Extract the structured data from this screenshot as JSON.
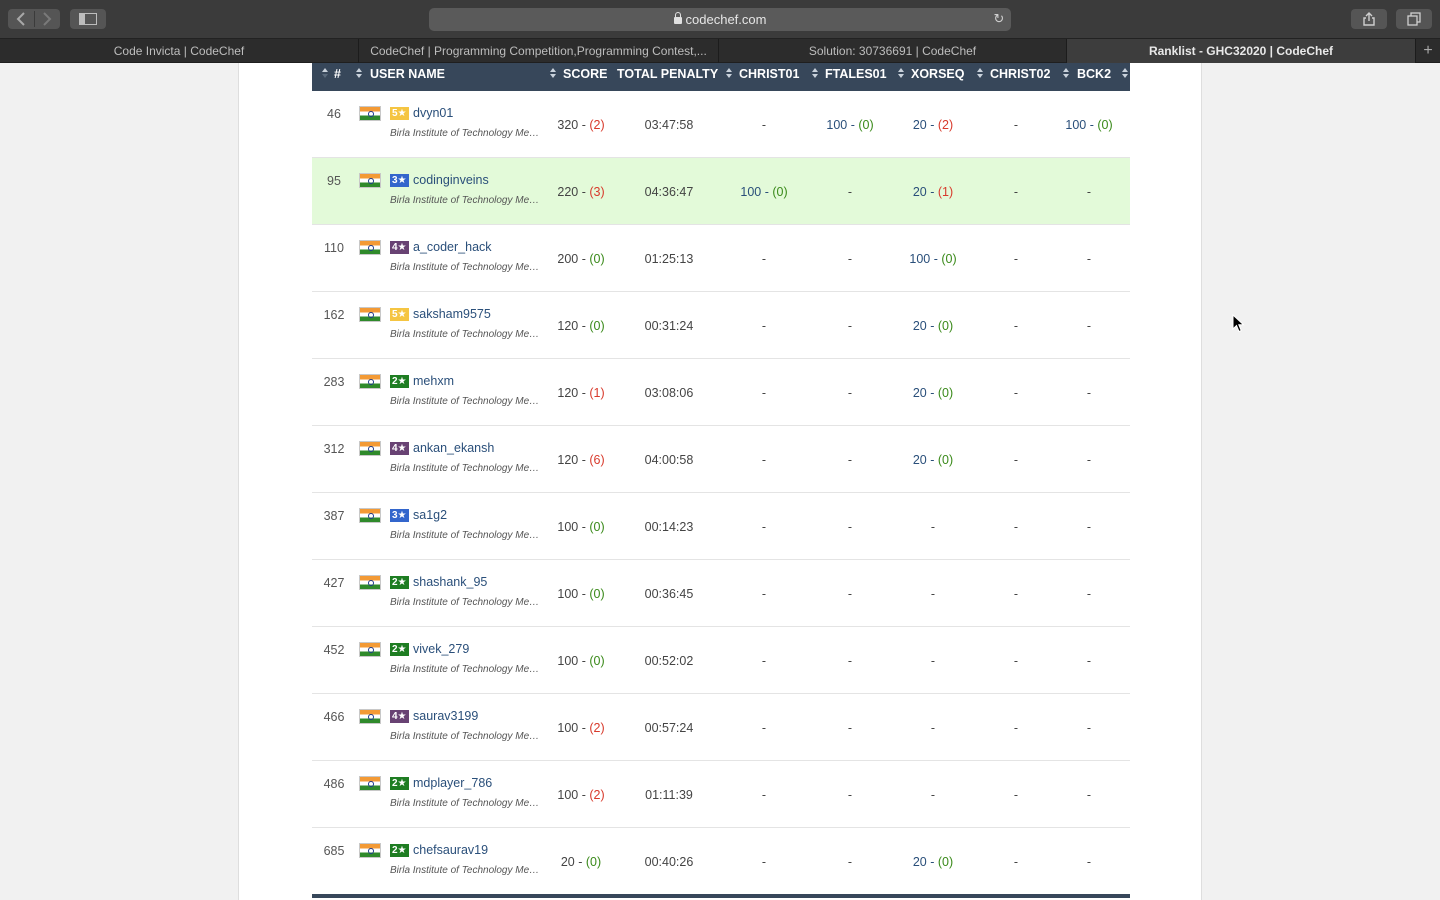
{
  "browser": {
    "url": "codechef.com",
    "tabs": [
      {
        "label": "Code Invicta | CodeChef"
      },
      {
        "label": "CodeChef | Programming Competition,Programming Contest,..."
      },
      {
        "label": "Solution: 30736691 | CodeChef"
      },
      {
        "label": "Ranklist - GHC32020 | CodeChef"
      }
    ]
  },
  "table": {
    "headers": {
      "rank": "#",
      "username": "USER NAME",
      "score": "SCORE",
      "penalty": "TOTAL PENALTY",
      "p1": "CHRIST01",
      "p2": "FTALES01",
      "p3": "XORSEQ",
      "p4": "CHRIST02",
      "p5": "BCK2"
    },
    "rows": [
      {
        "rank": "46",
        "stars": "5★",
        "user": "dvyn01",
        "inst": "Birla Institute of Technology Mesra",
        "score": "320",
        "score_pen": "(2)",
        "time": "03:47:58",
        "p1": "-",
        "p2": "100",
        "p2p": "(0)",
        "p3": "20",
        "p3p": "(2)",
        "p4": "-",
        "p5": "100",
        "p5p": "(0)"
      },
      {
        "rank": "95",
        "stars": "3★",
        "user": "codinginveins",
        "inst": "Birla Institute of Technology Mesra",
        "score": "220",
        "score_pen": "(3)",
        "time": "04:36:47",
        "p1": "100",
        "p1p": "(0)",
        "p2": "-",
        "p3": "20",
        "p3p": "(1)",
        "p4": "-",
        "p5": "-"
      },
      {
        "rank": "110",
        "stars": "4★",
        "user": "a_coder_hack",
        "inst": "Birla Institute of Technology Mesra",
        "score": "200",
        "score_pen": "(0)",
        "time": "01:25:13",
        "p1": "-",
        "p2": "-",
        "p3": "100",
        "p3p": "(0)",
        "p4": "-",
        "p5": "-"
      },
      {
        "rank": "162",
        "stars": "5★",
        "user": "saksham9575",
        "inst": "Birla Institute of Technology Mesra",
        "score": "120",
        "score_pen": "(0)",
        "time": "00:31:24",
        "p1": "-",
        "p2": "-",
        "p3": "20",
        "p3p": "(0)",
        "p4": "-",
        "p5": "-"
      },
      {
        "rank": "283",
        "stars": "2★",
        "user": "mehxm",
        "inst": "Birla Institute of Technology Mesra",
        "score": "120",
        "score_pen": "(1)",
        "time": "03:08:06",
        "p1": "-",
        "p2": "-",
        "p3": "20",
        "p3p": "(0)",
        "p4": "-",
        "p5": "-"
      },
      {
        "rank": "312",
        "stars": "4★",
        "user": "ankan_ekansh",
        "inst": "Birla Institute of Technology Mesra",
        "score": "120",
        "score_pen": "(6)",
        "time": "04:00:58",
        "p1": "-",
        "p2": "-",
        "p3": "20",
        "p3p": "(0)",
        "p4": "-",
        "p5": "-"
      },
      {
        "rank": "387",
        "stars": "3★",
        "user": "sa1g2",
        "inst": "Birla Institute of Technology Mesra",
        "score": "100",
        "score_pen": "(0)",
        "time": "00:14:23",
        "p1": "-",
        "p2": "-",
        "p3": "-",
        "p4": "-",
        "p5": "-"
      },
      {
        "rank": "427",
        "stars": "2★",
        "user": "shashank_95",
        "inst": "Birla Institute of Technology Mesra",
        "score": "100",
        "score_pen": "(0)",
        "time": "00:36:45",
        "p1": "-",
        "p2": "-",
        "p3": "-",
        "p4": "-",
        "p5": "-"
      },
      {
        "rank": "452",
        "stars": "2★",
        "user": "vivek_279",
        "inst": "Birla Institute of Technology Mesra",
        "score": "100",
        "score_pen": "(0)",
        "time": "00:52:02",
        "p1": "-",
        "p2": "-",
        "p3": "-",
        "p4": "-",
        "p5": "-"
      },
      {
        "rank": "466",
        "stars": "4★",
        "user": "saurav3199",
        "inst": "Birla Institute of Technology Mesra",
        "score": "100",
        "score_pen": "(2)",
        "time": "00:57:24",
        "p1": "-",
        "p2": "-",
        "p3": "-",
        "p4": "-",
        "p5": "-"
      },
      {
        "rank": "486",
        "stars": "2★",
        "user": "mdplayer_786",
        "inst": "Birla Institute of Technology Mesra",
        "score": "100",
        "score_pen": "(2)",
        "time": "01:11:39",
        "p1": "-",
        "p2": "-",
        "p3": "-",
        "p4": "-",
        "p5": "-"
      },
      {
        "rank": "685",
        "stars": "2★",
        "user": "chefsaurav19",
        "inst": "Birla Institute of Technology Mesra",
        "score": "20",
        "score_pen": "(0)",
        "time": "00:40:26",
        "p1": "-",
        "p2": "-",
        "p3": "20",
        "p3p": "(0)",
        "p4": "-",
        "p5": "-"
      }
    ]
  },
  "colors": {
    "header_bg": "#37475a",
    "highlight_row": "#e3fad9",
    "penalty_zero": "#3a8a1a",
    "penalty_nonzero": "#d83a2c",
    "username": "#2a4f7a"
  }
}
